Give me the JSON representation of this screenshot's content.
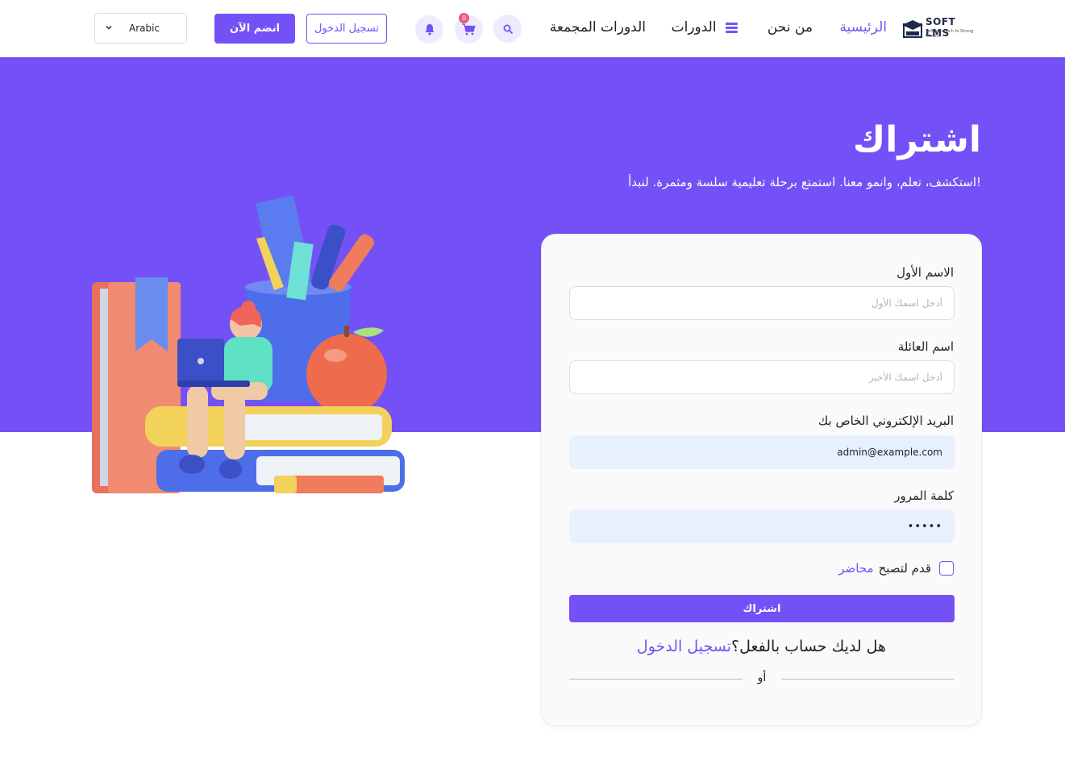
{
  "nav": {
    "logo_text": "SOFT LMS",
    "logo_sub": "Soft approach to Strong Results",
    "home": "الرئيسية",
    "about": "من نحن",
    "courses": "الدورات",
    "bundles": "الدورات المجمعة",
    "cart_count": "0",
    "login_label": "تسجيل الدخول",
    "join_label": "انضم الآن",
    "language": "Arabic",
    "icons": [
      "search-icon",
      "cart-icon",
      "bell-icon",
      "menu-icon",
      "chevron-down-icon"
    ]
  },
  "hero": {
    "title": "اشتراك",
    "subtitle": "استكشف، تعلم، وانمو معنا. استمتع برحلة تعليمية سلسة ومثمرة. لنبدأ!"
  },
  "form": {
    "first_name_label": "الاسم الأول",
    "first_name_placeholder": "أدخل اسمك الأول",
    "last_name_label": "اسم العائلة",
    "last_name_placeholder": "أدخل اسمك الأخير",
    "email_label": "البريد الإلكتروني الخاص بك",
    "email_value": "admin@example.com",
    "password_label": "كلمة المرور",
    "password_value": "•••••",
    "instructor_text": "قدم لتصبح",
    "instructor_link": "محاضر",
    "submit_label": "اشتراك",
    "have_account_text": "هل لديك حساب بالفعل؟",
    "login_link": "تسجيل الدخول",
    "or_text": "أو"
  },
  "colors": {
    "primary": "#7351f6",
    "badge": "#f2577b"
  }
}
